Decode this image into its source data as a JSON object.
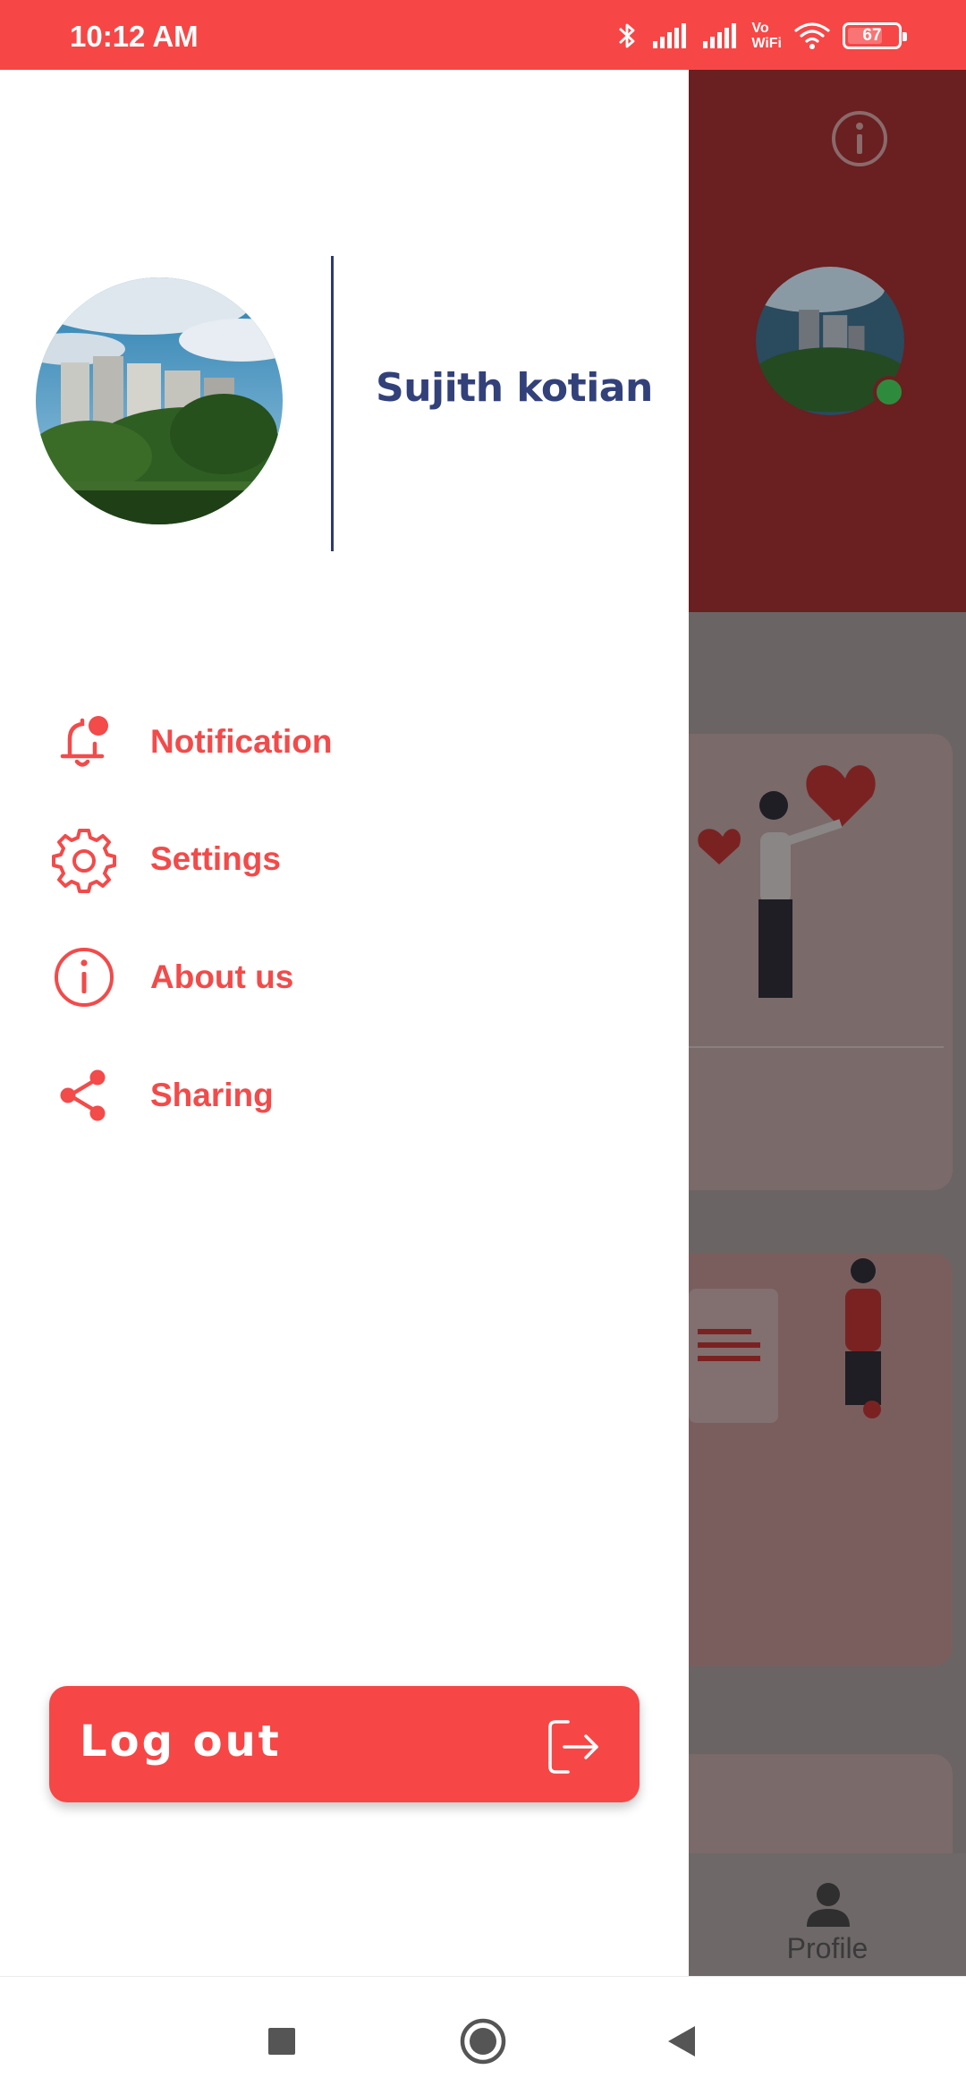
{
  "status_bar": {
    "time": "10:12 AM",
    "battery": "67",
    "wifi_label_top": "Vo",
    "wifi_label_bottom": "WiFi"
  },
  "drawer": {
    "user_name": "Sujith kotian",
    "menu": [
      {
        "label": "Notification",
        "icon": "notification-bell-icon"
      },
      {
        "label": "Settings",
        "icon": "settings-gear-icon"
      },
      {
        "label": "About us",
        "icon": "info-icon"
      },
      {
        "label": "Sharing",
        "icon": "share-icon"
      }
    ],
    "logout_label": "Log out"
  },
  "background": {
    "bottom_tab_label": "Profile"
  },
  "colors": {
    "accent": "#f74646",
    "name_color": "#33417a",
    "header_dim": "#6a1f20",
    "online": "#2e8b3d"
  },
  "nav": {
    "buttons": [
      "recent-apps",
      "home",
      "back"
    ]
  }
}
